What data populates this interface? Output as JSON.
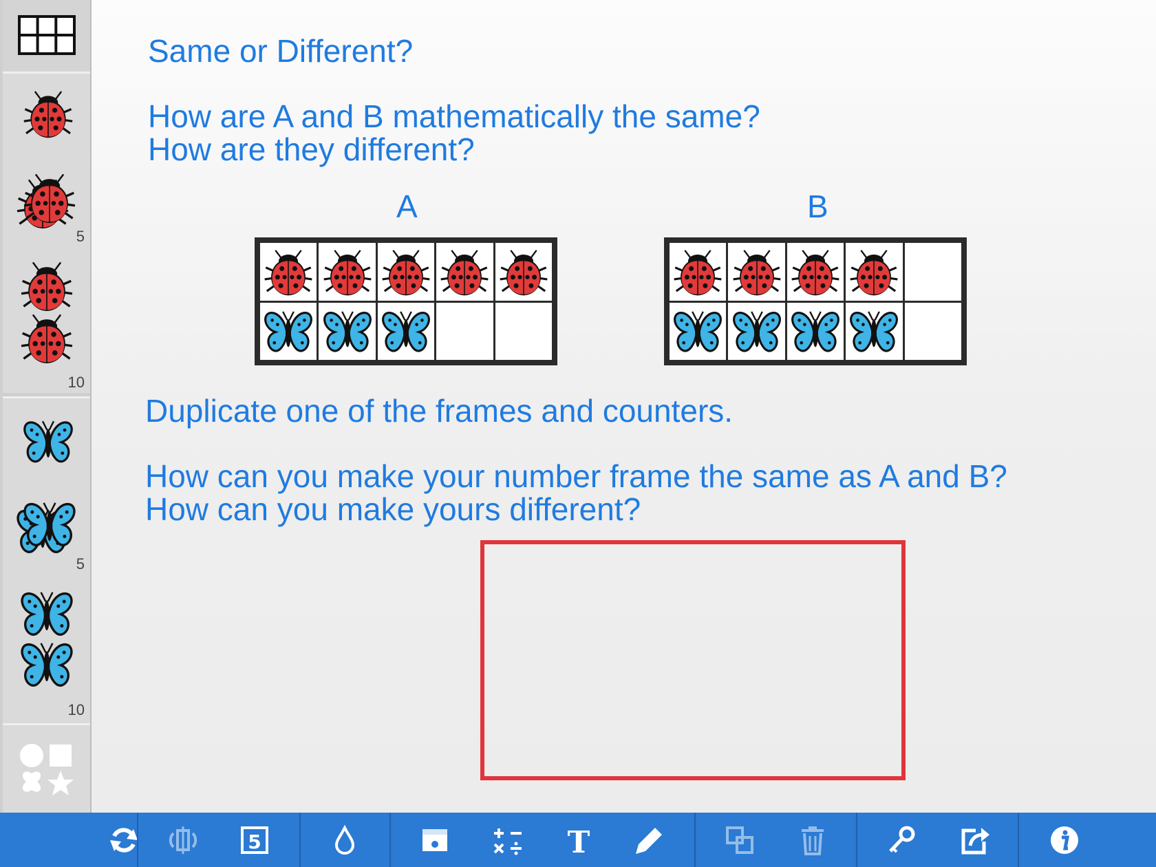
{
  "canvas": {
    "title": "Same or Different?",
    "question1": "How are A and B mathematically the same?",
    "question2": "How are they different?",
    "frame_a_label": "A",
    "frame_b_label": "B",
    "instruction": "Duplicate one of the frames and counters.",
    "question3": "How can you make your number frame the same as A and B?",
    "question4": "How can you make yours different?"
  },
  "frames": {
    "A": {
      "top_row": [
        "ladybird",
        "ladybird",
        "ladybird",
        "ladybird",
        "ladybird"
      ],
      "bottom_row": [
        "butterfly",
        "butterfly",
        "butterfly",
        "empty",
        "empty"
      ]
    },
    "B": {
      "top_row": [
        "ladybird",
        "ladybird",
        "ladybird",
        "ladybird",
        "empty"
      ],
      "bottom_row": [
        "butterfly",
        "butterfly",
        "butterfly",
        "butterfly",
        "empty"
      ]
    }
  },
  "sidebar": {
    "ladybird_stack5_count": "5",
    "ladybird_stack10_count": "10",
    "butterfly_stack5_count": "5",
    "butterfly_stack10_count": "10"
  },
  "toolbar": {
    "tools": [
      "refresh-icon",
      "flip-icon",
      "number-card-icon",
      "paint-drop-icon",
      "image-icon",
      "operations-icon",
      "text-icon",
      "pen-icon",
      "duplicate-icon",
      "trash-icon",
      "key-icon",
      "share-icon",
      "info-icon"
    ]
  },
  "colors": {
    "accent": "#1f7be0",
    "toolbar": "#2b7ad3",
    "answer_box": "#e0353a",
    "ladybird_red": "#e23a3a",
    "butterfly_blue": "#3fb4e6"
  }
}
